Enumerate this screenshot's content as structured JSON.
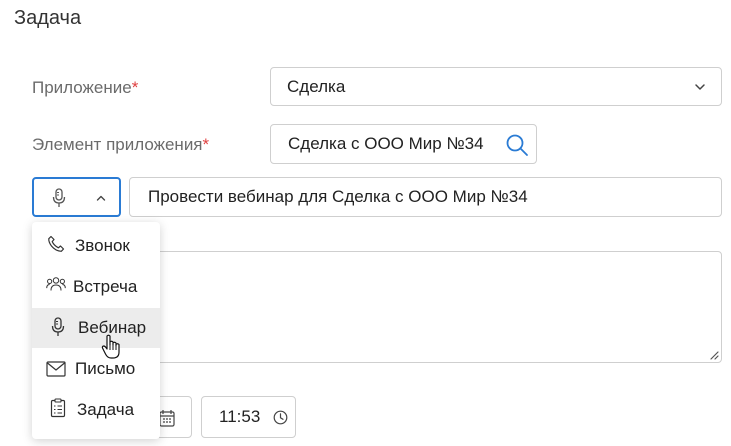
{
  "form": {
    "title": "Задача",
    "application": {
      "label": "Приложение",
      "required_mark": "*",
      "value": "Сделка",
      "icon": "chevron-down-icon"
    },
    "app_element": {
      "label": "Элемент приложения",
      "required_mark": "*",
      "value": "Сделка с ООО Мир №34",
      "icon": "search-icon"
    },
    "task_type": {
      "selected_icon": "microphone-icon",
      "state": "open"
    },
    "subject": {
      "value": "Провести вебинар для Сделка с ООО Мир №34"
    },
    "time": {
      "value": "11:53",
      "icon": "clock-icon"
    },
    "date": {
      "icon": "calendar-icon"
    }
  },
  "dropdown": {
    "items": [
      {
        "label": "Звонок",
        "icon": "phone-icon"
      },
      {
        "label": "Встреча",
        "icon": "people-icon"
      },
      {
        "label": "Вебинар",
        "icon": "microphone-icon",
        "hovered": true
      },
      {
        "label": "Письмо",
        "icon": "envelope-icon"
      },
      {
        "label": "Задача",
        "icon": "checklist-icon"
      }
    ]
  },
  "colors": {
    "accent": "#2a7bd4",
    "required": "#e04040",
    "label": "#6b6b6b",
    "border": "#cfcfcf",
    "hover": "#ececec"
  }
}
